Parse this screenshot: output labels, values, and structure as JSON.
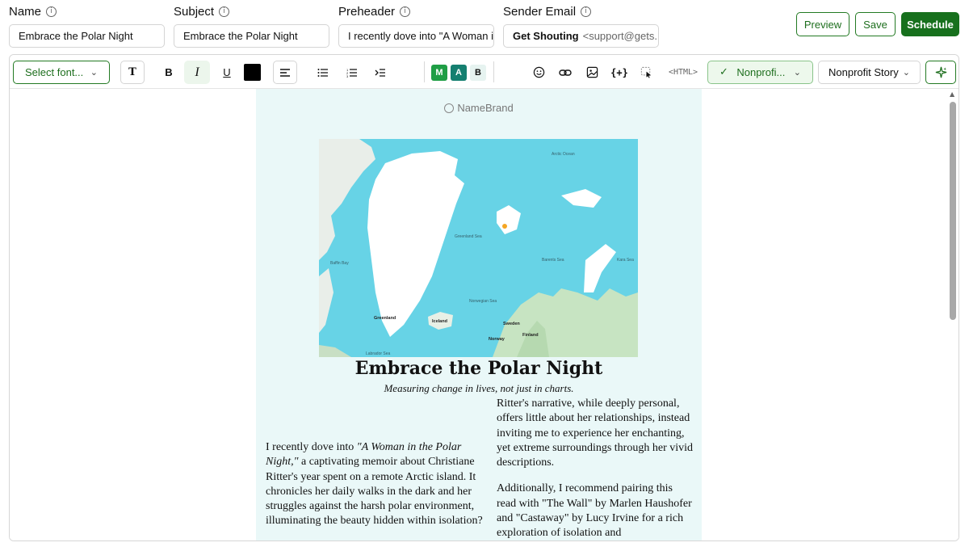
{
  "fields": {
    "name": {
      "label": "Name",
      "value": "Embrace the Polar Night"
    },
    "subject": {
      "label": "Subject",
      "value": "Embrace the Polar Night"
    },
    "preheader": {
      "label": "Preheader",
      "value": "I recently dove into \"A Woman in"
    },
    "sender": {
      "label": "Sender Email",
      "name": "Get Shouting",
      "email": "<support@gets..."
    }
  },
  "actions": {
    "preview": "Preview",
    "save": "Save",
    "schedule": "Schedule"
  },
  "toolbar": {
    "font_select": "Select font...",
    "text_type": "T",
    "bold": "B",
    "italic": "I",
    "underline": "U",
    "text_color": "#000000",
    "mab": {
      "m": "M",
      "a": "A",
      "b": "B"
    },
    "merge_tags": "{+}",
    "html": "<HTML>",
    "template_select": "Nonprofi...",
    "story_select": "Nonprofit Story"
  },
  "email": {
    "brand": "NameBrand",
    "map_labels": {
      "arctic_ocean": "Arctic Ocean",
      "greenland_sea": "Greenland Sea",
      "barents_sea": "Barents Sea",
      "kara_sea": "Kara Sea",
      "baffin_bay": "Baffin Bay",
      "norwegian_sea": "Norwegian Sea",
      "greenland": "Greenland",
      "iceland": "Iceland",
      "sweden": "Sweden",
      "norway": "Norway",
      "finland": "Finland",
      "labrador_sea": "Labrador Sea"
    },
    "title": "Embrace the Polar Night",
    "subtitle": "Measuring change in lives, not just in charts.",
    "left_text_pre": "I recently dove into ",
    "left_text_em": "\"A Woman in the Polar Night,\"",
    "left_text_post": " a captivating memoir about Christiane Ritter's year spent on a remote Arctic island. It chronicles her daily walks in the dark and her struggles against the harsh polar environment, illuminating the beauty hidden within isolation?",
    "right_p1": "Ritter's narrative, while deeply personal, offers little about her relationships, instead inviting me to experience her enchanting, yet extreme surroundings through her vivid descriptions.",
    "right_p2": "Additionally, I recommend pairing this read with \"The Wall\" by Marlen Haushofer and \"Castaway\" by Lucy Irvine for a rich exploration of isolation and"
  },
  "colors": {
    "accent": "#17701d",
    "email_bg": "#eaf8f8",
    "sea": "#67d3e6",
    "m_badge": "#1f9e45",
    "a_badge": "#157f70"
  }
}
